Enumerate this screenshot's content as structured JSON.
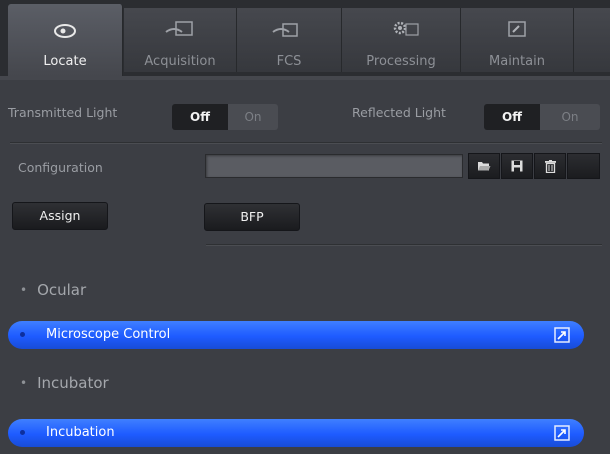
{
  "tabs": [
    {
      "label": "Locate",
      "icon": "eye-icon",
      "active": true
    },
    {
      "label": "Acquisition",
      "icon": "acquisition-icon",
      "active": false
    },
    {
      "label": "FCS",
      "icon": "fcs-icon",
      "active": false
    },
    {
      "label": "Processing",
      "icon": "gear-icon",
      "active": false
    },
    {
      "label": "Maintain",
      "icon": "maintain-icon",
      "active": false
    }
  ],
  "lights": {
    "transmitted": {
      "label": "Transmitted Light",
      "off": "Off",
      "on": "On",
      "selected": "Off"
    },
    "reflected": {
      "label": "Reflected Light",
      "off": "Off",
      "on": "On",
      "selected": "Off"
    }
  },
  "configuration": {
    "label": "Configuration",
    "value": "",
    "buttons": [
      "open-folder-icon",
      "save-icon",
      "delete-icon"
    ]
  },
  "assign_label": "Assign",
  "bfp_label": "BFP",
  "sections": [
    {
      "group": "Ocular",
      "bar": "Microscope Control"
    },
    {
      "group": "Incubator",
      "bar": "Incubation"
    }
  ],
  "colors": {
    "panel": "#3c3e44",
    "accent_blue": "#1e5bff",
    "tab_bar": "#2b2d31"
  }
}
